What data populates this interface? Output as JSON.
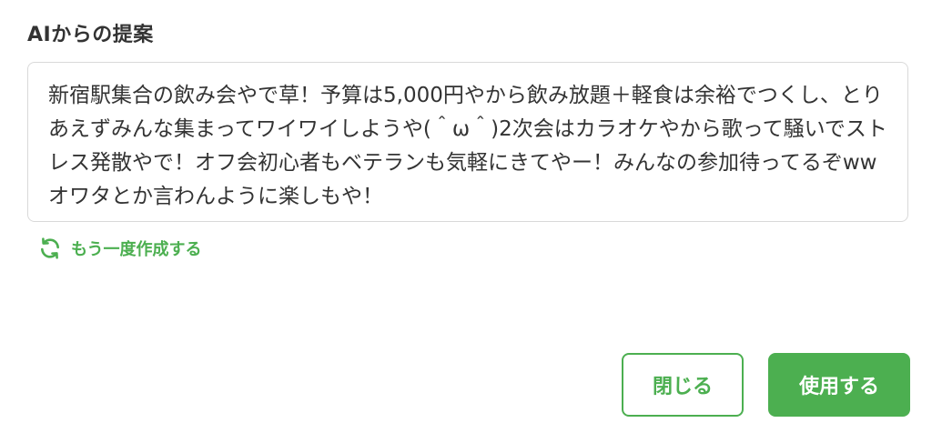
{
  "dialog": {
    "heading": "AIからの提案",
    "suggestion_text": "新宿駅集合の飲み会やで草！予算は5,000円やから飲み放題＋軽食は余裕でつくし、とりあえずみんな集まってワイワイしようや(＾ω＾)2次会はカラオケやから歌って騒いでストレス発散やで！オフ会初心者もベテランも気軽にきてやー！みんなの参加待ってるぞww オワタとか言わんように楽しもや！",
    "regenerate_label": "もう一度作成する",
    "close_label": "閉じる",
    "use_label": "使用する"
  },
  "icons": {
    "regenerate": "refresh-icon"
  },
  "colors": {
    "accent": "#4caf50",
    "text": "#333333",
    "border": "#d9d9d9"
  }
}
